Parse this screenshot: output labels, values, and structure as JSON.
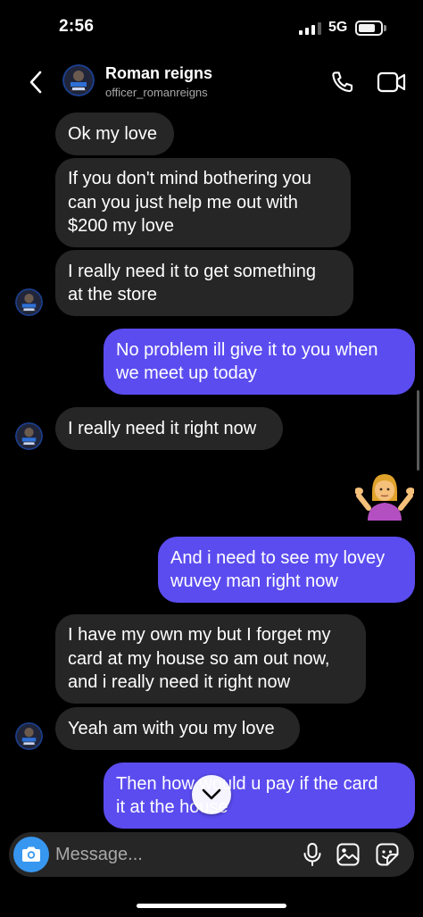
{
  "status_bar": {
    "time": "2:56",
    "network": "5G",
    "signal_bars_active": 3,
    "signal_bars_total": 4,
    "battery_level": 0.7
  },
  "header": {
    "name": "Roman reigns",
    "username": "officer_romanreigns",
    "back_icon": "chevron-left-icon",
    "call_icon": "phone-icon",
    "video_icon": "video-camera-icon"
  },
  "messages": [
    {
      "sender": "them",
      "lines": [
        "Ok my love"
      ]
    },
    {
      "sender": "them",
      "lines": [
        "If you don't mind bothering you",
        "can you just help me out with",
        "$200 my love"
      ]
    },
    {
      "sender": "them",
      "lines": [
        "I really need it to get something",
        "at the store"
      ]
    },
    {
      "sender": "me",
      "lines": [
        "No problem ill give it to you when",
        "we meet up today"
      ]
    },
    {
      "sender": "them",
      "lines": [
        "I really need it right now"
      ]
    },
    {
      "sender": "me",
      "emoji": "🤷‍♀️"
    },
    {
      "sender": "me",
      "lines": [
        "And i need to see my lovey",
        "wuvey man right now"
      ]
    },
    {
      "sender": "them",
      "lines": [
        "I have my own my but I forget my",
        "card at my house so am out now,",
        "and i really need it right now"
      ]
    },
    {
      "sender": "them",
      "lines": [
        "Yeah am with you my love"
      ]
    },
    {
      "sender": "me",
      "lines": [
        "Then how would u pay if the card",
        "it at the house"
      ]
    }
  ],
  "composer": {
    "placeholder": "Message...",
    "camera_icon": "camera-icon",
    "mic_icon": "microphone-icon",
    "gallery_icon": "image-gallery-icon",
    "sticker_icon": "sticker-icon"
  },
  "scroll_down_icon": "chevron-down-icon",
  "colors": {
    "background": "#000000",
    "incoming_bubble": "#262626",
    "outgoing_bubble": "#5b4cf0",
    "camera_button": "#3797f0",
    "secondary_text": "#a8a8a8"
  }
}
